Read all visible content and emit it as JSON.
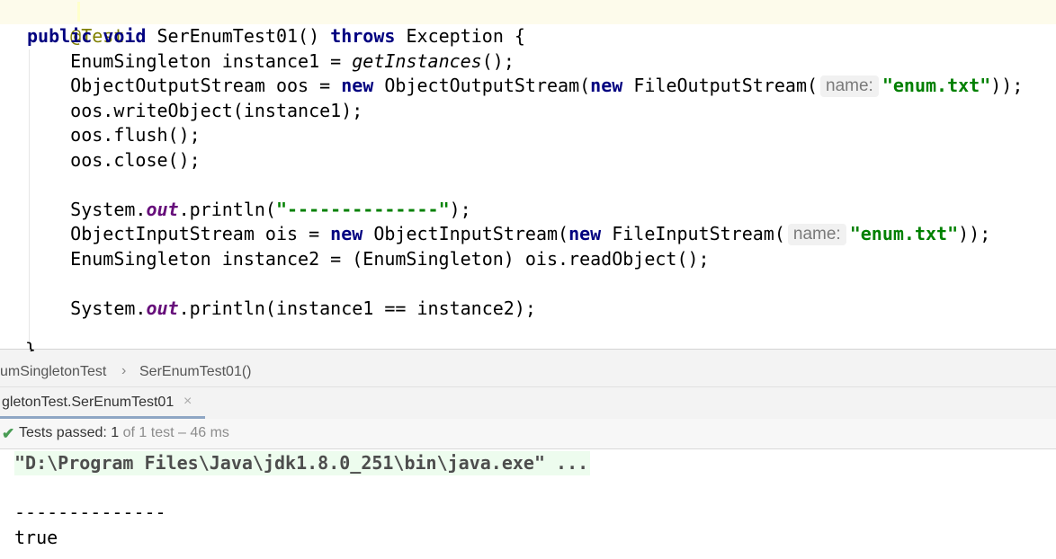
{
  "editor": {
    "annotation": "@Test",
    "method_signature": {
      "kw_public": "public",
      "kw_void": "void",
      "name": "SerEnumTest01()",
      "kw_throws": "throws",
      "exception": "Exception {"
    },
    "lines": {
      "l1_prefix": "    EnumSingleton instance1 = ",
      "l1_call": "getInstances",
      "l1_suffix": "();",
      "l2_prefix": "    ObjectOutputStream oos = ",
      "l2_new1": "new",
      "l2_mid": " ObjectOutputStream(",
      "l2_new2": "new",
      "l2_mid2": " FileOutputStream(",
      "l2_hint": "name:",
      "l2_str": "\"enum.txt\"",
      "l2_end": "));",
      "l3": "    oos.writeObject(instance1);",
      "l4": "    oos.flush();",
      "l5": "    oos.close();",
      "l6_prefix": "    System.",
      "l6_field": "out",
      "l6_mid": ".println(",
      "l6_str": "\"--------------\"",
      "l6_end": ");",
      "l7_prefix": "    ObjectInputStream ois = ",
      "l7_new1": "new",
      "l7_mid": " ObjectInputStream(",
      "l7_new2": "new",
      "l7_mid2": " FileInputStream(",
      "l7_hint": "name:",
      "l7_str": "\"enum.txt\"",
      "l7_end": "));",
      "l8": "    EnumSingleton instance2 = (EnumSingleton) ois.readObject();",
      "l9_prefix": "    System.",
      "l9_field": "out",
      "l9_end": ".println(instance1 == instance2);",
      "closing": "}"
    }
  },
  "breadcrumb": {
    "class_item": "umSingletonTest",
    "separator": "›",
    "method_item": "SerEnumTest01()"
  },
  "run_tab": {
    "label": "gletonTest.SerEnumTest01",
    "close": "×"
  },
  "status": {
    "check": "✔",
    "label": "Tests passed: ",
    "count": "1",
    "detail": " of 1 test – 46 ms"
  },
  "console": {
    "command": "\"D:\\Program Files\\Java\\jdk1.8.0_251\\bin\\java.exe\" ...",
    "separator": "--------------",
    "result": "true"
  },
  "colors": {
    "keyword": "#000080",
    "string": "#008000",
    "annotation": "#808000",
    "field": "#660e7a",
    "pass_green": "#499c54"
  }
}
